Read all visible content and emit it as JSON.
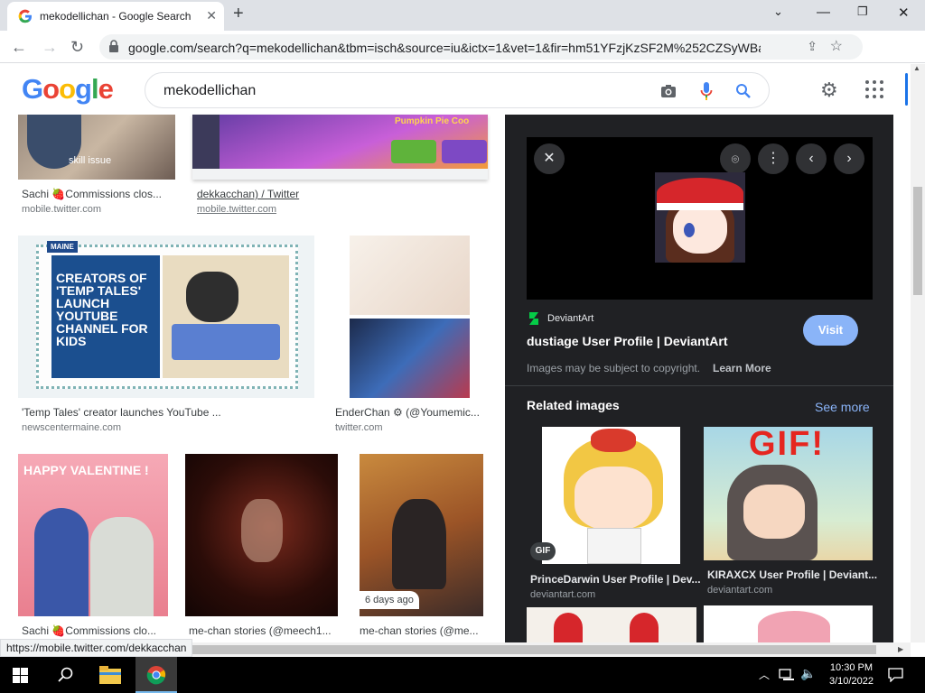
{
  "browser": {
    "tab_title": "mekodellichan - Google Search",
    "url": "google.com/search?q=mekodellichan&tbm=isch&source=iu&ictx=1&vet=1&fir=hm51YFzjKzSF2M%252CZSyWBaVc...",
    "status_url": "https://mobile.twitter.com/dekkacchan"
  },
  "google": {
    "logo": "Google",
    "query": "mekodellichan",
    "brand_colors": [
      "#4285F4",
      "#EA4335",
      "#FBBC05",
      "#34A853"
    ]
  },
  "results": [
    {
      "caption": "Sachi 🍓Commissions clos...",
      "source": "mobile.twitter.com",
      "overlay": "skill issue"
    },
    {
      "caption": "dekkacchan) / Twitter",
      "source": "mobile.twitter.com",
      "overlay": "Pumpkin Pie Coo"
    },
    {
      "caption": "'Temp Tales' creator launches YouTube ...",
      "source": "newscentermaine.com",
      "overlay": "CREATORS OF 'TEMP TALES' LAUNCH YOUTUBE CHANNEL FOR KIDS",
      "badge": "MAINE"
    },
    {
      "caption": "EnderChan ⚙ (@Youmemic...",
      "source": "twitter.com"
    },
    {
      "caption": "Sachi 🍓Commissions clo...",
      "source": "",
      "overlay": "HAPPY VALENTINE !"
    },
    {
      "caption": "me-chan stories (@meech1...",
      "source": ""
    },
    {
      "caption": "me-chan stories (@me...",
      "source": "",
      "badge": "6 days ago"
    }
  ],
  "panel": {
    "site": "DeviantArt",
    "title": "dustiage User Profile | DeviantArt",
    "visit_label": "Visit",
    "copyright": "Images may be subject to copyright.",
    "learn_more": "Learn More",
    "related_heading": "Related images",
    "see_more": "See more",
    "related": [
      {
        "title": "PrinceDarwin User Profile | Dev...",
        "source": "deviantart.com",
        "badge": "GIF"
      },
      {
        "title": "KIRAXCX User Profile | Deviant...",
        "source": "deviantart.com",
        "overlay": "GIF!"
      }
    ]
  },
  "taskbar": {
    "time": "10:30 PM",
    "date": "3/10/2022"
  }
}
